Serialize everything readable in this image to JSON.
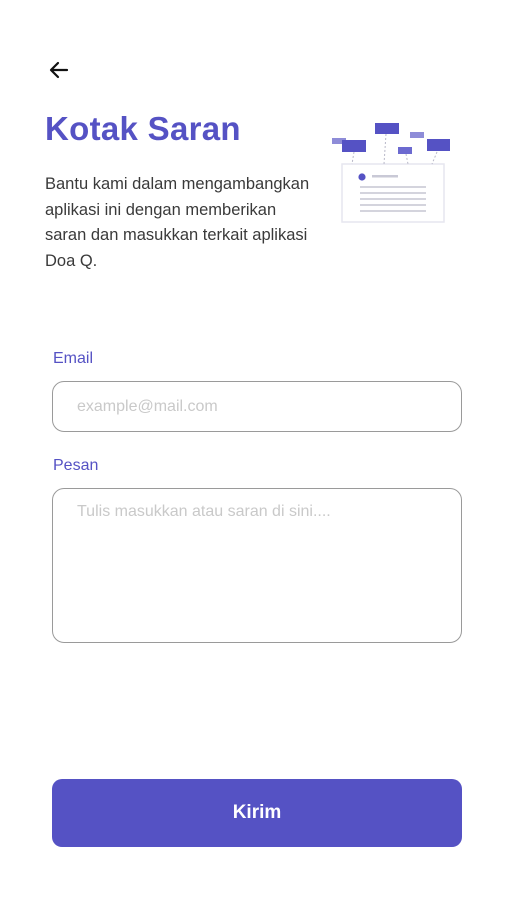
{
  "header": {
    "back_icon": "arrow-left-icon",
    "title": "Kotak Saran",
    "description": "Bantu kami dalam mengambangkan aplikasi ini dengan memberikan saran dan masukkan terkait aplikasi Doa Q.",
    "illustration": "feedback-illustration"
  },
  "form": {
    "email_label": "Email",
    "email_placeholder": "example@mail.com",
    "email_value": "",
    "message_label": "Pesan",
    "message_placeholder": "Tulis masukkan atau saran di sini....",
    "message_value": ""
  },
  "submit": {
    "label": "Kirim"
  },
  "colors": {
    "accent": "#5552c4",
    "border": "#9a9a9a",
    "placeholder": "#c9c9c9",
    "text": "#3a3a3a"
  }
}
